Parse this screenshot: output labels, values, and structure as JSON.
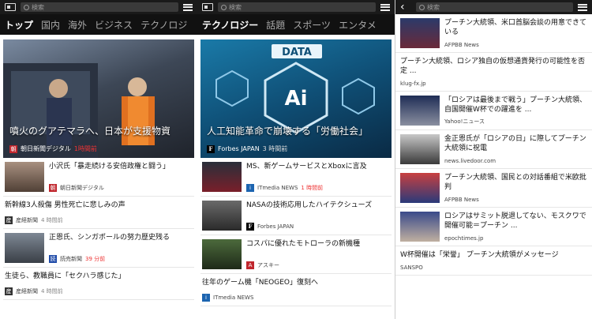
{
  "left": {
    "search_placeholder": "検索",
    "tabs": [
      "トップ",
      "国内",
      "海外",
      "ビジネス",
      "テクノロジ"
    ],
    "hero": {
      "title": "噴火のグアテマラへ、日本が支援物資",
      "source": "朝日新聞デジタル",
      "time": "1時間前",
      "logo": "朝"
    },
    "items": [
      {
        "title": "小沢氏「暴走続ける安倍政権と闘う」",
        "source": "朝日新聞デジタル",
        "time": "",
        "logo": "朝"
      },
      {
        "title": "新幹線3人殺傷 男性死亡に悲しみの声",
        "source": "産経新聞",
        "time": "4 時間前",
        "logo": "産"
      },
      {
        "title": "正恩氏、シンガポールの努力歴史残る",
        "source": "読売新聞",
        "time": "39 分前",
        "logo": "読"
      },
      {
        "title": "生徒ら、教職員に「セクハラ感じた」",
        "source": "産経新聞",
        "time": "4 時間前",
        "logo": "産"
      }
    ]
  },
  "middle": {
    "search_placeholder": "検索",
    "tabs": [
      "テクノロジー",
      "話題",
      "スポーツ",
      "エンタメ"
    ],
    "hero": {
      "title": "人工知能革命で崩壊する「労働社会」",
      "source": "Forbes JAPAN",
      "time": "3 時間前",
      "logo": "F",
      "image_text": "DATA",
      "image_text2": "Ai"
    },
    "items": [
      {
        "title": "MS、新ゲームサービスとXboxに言及",
        "source": "ITmedia NEWS",
        "time": "1 時間前",
        "logo": "i"
      },
      {
        "title": "NASAの技術応用したハイテクシューズ",
        "source": "Forbes JAPAN",
        "time": "",
        "logo": "F"
      },
      {
        "title": "コスパに優れたモトローラの新機種",
        "source": "アスキー",
        "time": "",
        "logo": "A"
      },
      {
        "title": "往年のゲーム機「NEOGEO」復刻へ",
        "source": "ITmedia NEWS",
        "time": "",
        "logo": "i"
      }
    ]
  },
  "right": {
    "search_placeholder": "検索",
    "items": [
      {
        "title": "プーチン大統領、米口首脳会談の用意できている",
        "source": "AFPBB News",
        "thumb": true
      },
      {
        "title": "プーチン大統領、ロシア独自の仮想通貨発行の可能性を否定 ...",
        "source": "klug-fx.jp",
        "thumb": false
      },
      {
        "title": "「ロシアは最後まで戦う」プーチン大統領、自国開催W杯での躍進を ...",
        "source": "Yahoo!ニュース",
        "thumb": true
      },
      {
        "title": "金正恩氏が「ロシアの日」に際してプーチン大統領に祝電",
        "source": "news.livedoor.com",
        "thumb": true
      },
      {
        "title": "プーチン大統領、国民との対話番組で米欧批判",
        "source": "AFPBB News",
        "thumb": true
      },
      {
        "title": "ロシアはサミット脱退してない、モスクワで開催可能＝プーチン ...",
        "source": "epochtimes.jp",
        "thumb": true
      },
      {
        "title": "W杯開催は「栄誉」 プーチン大統領がメッセージ",
        "source": "SANSPO",
        "thumb": false
      }
    ]
  }
}
